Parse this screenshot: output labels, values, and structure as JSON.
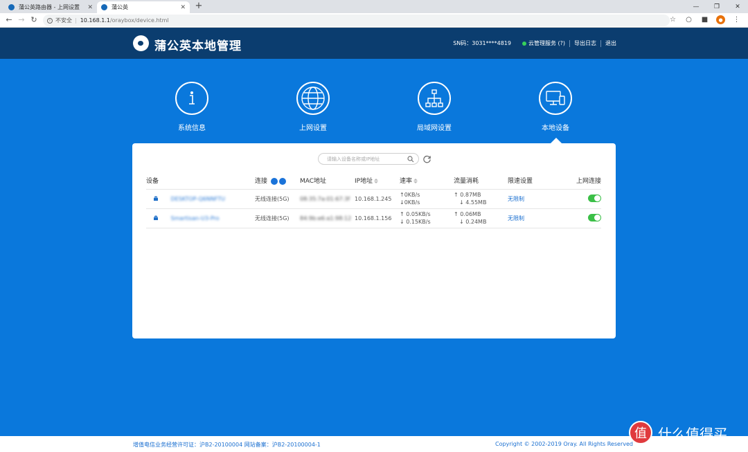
{
  "browser": {
    "tabs": [
      {
        "title": "蒲公英路由器 - 上网设置",
        "active": false
      },
      {
        "title": "蒲公英",
        "active": true
      }
    ],
    "omnibox": {
      "insecure": "不安全",
      "host": "10.168.1.1",
      "path": "/oraybox/device.html"
    }
  },
  "header": {
    "brand": "蒲公英本地管理",
    "sn": "SN码：3031****4819",
    "cloud_service": "云管理服务 (?)",
    "export_log": "导出日志",
    "logout": "退出"
  },
  "nav": [
    {
      "label": "系统信息",
      "icon": "info-icon"
    },
    {
      "label": "上网设置",
      "icon": "globe-icon"
    },
    {
      "label": "局域网设置",
      "icon": "network-icon"
    },
    {
      "label": "本地设备",
      "icon": "monitor-icon",
      "active": true
    }
  ],
  "search": {
    "placeholder": "请输入设备名称或IP地址"
  },
  "table": {
    "headers": {
      "device": "设备",
      "connection": "连接",
      "mac": "MAC地址",
      "ip": "IP地址",
      "speed": "速率",
      "traffic": "流量消耗",
      "limit": "限速设置",
      "online": "上网连接"
    },
    "rows": [
      {
        "name": "DESKTOP-Q6NNFTU",
        "connection": "无线连接(5G)",
        "mac": "08:35:7a:01:67:3f",
        "ip": "10.168.1.245",
        "speed_up": "↑0KB/s",
        "speed_down": "↓0KB/s",
        "traffic_up": "↑ 0.87MB",
        "traffic_down": "↓ 4.55MB",
        "limit": "无限制",
        "online": true
      },
      {
        "name": "Smartisan-U3-Pro",
        "connection": "无线连接(5G)",
        "mac": "84:9b:e6:a1:98:12",
        "ip": "10.168.1.156",
        "speed_up": "↑ 0.05KB/s",
        "speed_down": "↓ 0.15KB/s",
        "traffic_up": "↑ 0.06MB",
        "traffic_down": "↓ 0.24MB",
        "limit": "无限制",
        "online": true
      }
    ]
  },
  "footer": {
    "license": "增值电信业务经营许可证：沪B2-20100004 网站备案：沪B2-20100004-1",
    "copyright": "Copyright © 2002-2019 Oray. All Rights Reserved"
  },
  "watermark": {
    "text": "什么值得买",
    "mark": "值"
  },
  "colors": {
    "accent": "#0a78dc",
    "header_bg": "#0b3d6f",
    "toggle_on": "#3bbf47"
  }
}
